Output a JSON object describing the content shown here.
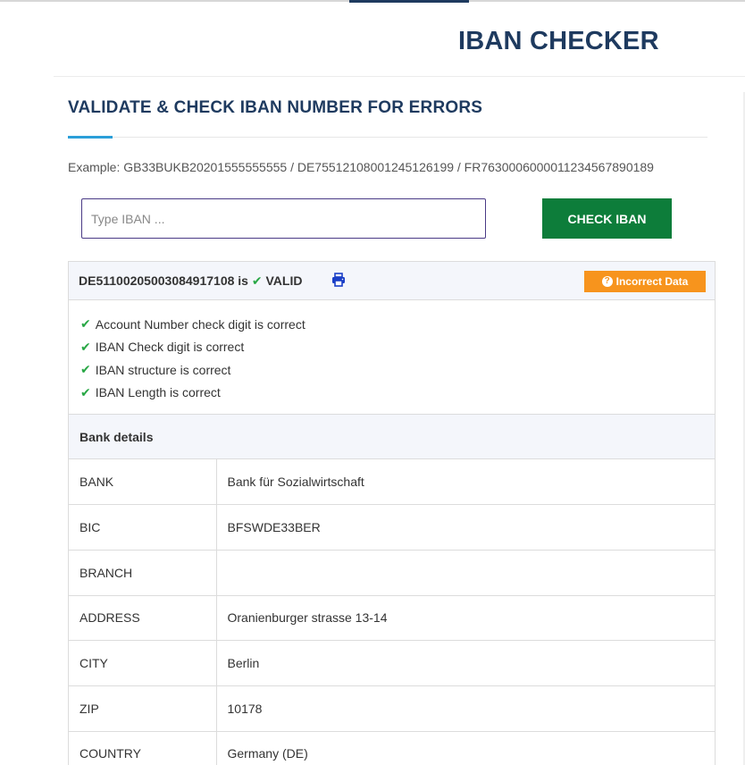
{
  "header": {
    "title": "IBAN CHECKER"
  },
  "section": {
    "title": "VALIDATE & CHECK IBAN NUMBER FOR ERRORS"
  },
  "example": {
    "text": "Example: GB33BUKB20201555555555 / DE75512108001245126199 / FR7630006000011234567890189"
  },
  "form": {
    "input_placeholder": "Type IBAN ...",
    "input_value": "",
    "check_label": "CHECK IBAN"
  },
  "result": {
    "iban_prefix": "DE51100205003084917108 is",
    "status": "VALID",
    "incorrect_label": "Incorrect Data",
    "checks": [
      "Account Number check digit is correct",
      "IBAN Check digit is correct",
      "IBAN structure is correct",
      "IBAN Length is correct"
    ]
  },
  "bank": {
    "title": "Bank details",
    "rows": [
      {
        "key": "BANK",
        "value": "Bank für Sozialwirtschaft"
      },
      {
        "key": "BIC",
        "value": "BFSWDE33BER"
      },
      {
        "key": "BRANCH",
        "value": ""
      },
      {
        "key": "ADDRESS",
        "value": "Oranienburger strasse 13-14"
      },
      {
        "key": "CITY",
        "value": "Berlin"
      },
      {
        "key": "ZIP",
        "value": "10178"
      },
      {
        "key": "COUNTRY",
        "value": "Germany (DE)"
      }
    ]
  },
  "colors": {
    "brand_navy": "#1e3a5f",
    "accent_blue": "#2b9fd9",
    "check_green": "#0d7d3a",
    "valid_green": "#28a745",
    "incorrect_orange": "#f7941d",
    "print_blue": "#1a3fc7"
  },
  "icons": {
    "check": "check-icon",
    "print": "print-icon",
    "question": "question-circle-icon"
  }
}
